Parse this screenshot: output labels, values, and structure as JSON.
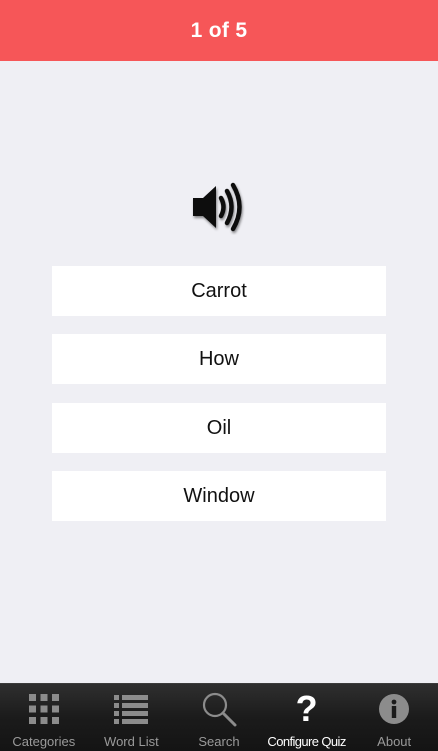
{
  "header": {
    "title": "1 of 5"
  },
  "quiz": {
    "audio_icon": "speaker-volume-icon",
    "answers": [
      "Carrot",
      "How",
      "Oil",
      "Window"
    ]
  },
  "tabbar": {
    "tabs": [
      {
        "label": "Categories",
        "icon": "grid-icon"
      },
      {
        "label": "Word List",
        "icon": "list-icon"
      },
      {
        "label": "Search",
        "icon": "magnifier-icon"
      },
      {
        "label": "Configure Quiz",
        "icon": "question-mark-icon",
        "active": true
      },
      {
        "label": "About",
        "icon": "info-icon"
      }
    ]
  },
  "colors": {
    "header_bg": "#f65658",
    "page_bg": "#efeff4",
    "tabbar_bg": "#1b1b1b",
    "tab_active": "#ffffff",
    "tab_inactive": "#9a9a9a"
  }
}
